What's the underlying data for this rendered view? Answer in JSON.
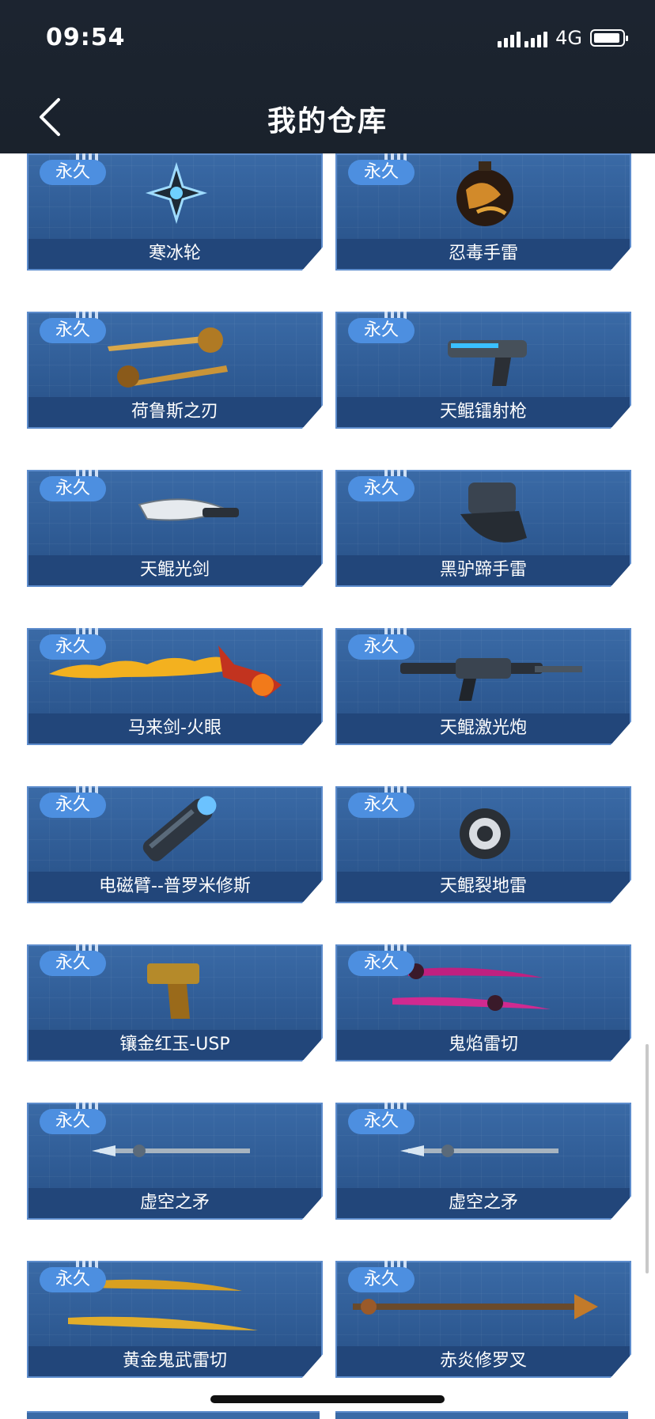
{
  "status": {
    "time": "09:54",
    "network": "4G"
  },
  "header": {
    "title": "我的仓库"
  },
  "items": [
    {
      "badge": "永久",
      "name": "寒冰轮",
      "icon": "shuriken-icon"
    },
    {
      "badge": "永久",
      "name": "忍毒手雷",
      "icon": "grenade-icon"
    },
    {
      "badge": "永久",
      "name": "荷鲁斯之刃",
      "icon": "dagger-icon"
    },
    {
      "badge": "永久",
      "name": "天鲲镭射枪",
      "icon": "laser-pistol-icon"
    },
    {
      "badge": "永久",
      "name": "天鲲光剑",
      "icon": "lightsaber-icon"
    },
    {
      "badge": "永久",
      "name": "黑驴蹄手雷",
      "icon": "hoof-grenade-icon"
    },
    {
      "badge": "永久",
      "name": "马来剑-火眼",
      "icon": "flame-sword-icon"
    },
    {
      "badge": "永久",
      "name": "天鲲激光炮",
      "icon": "laser-cannon-icon"
    },
    {
      "badge": "永久",
      "name": "电磁臂--普罗米修斯",
      "icon": "arm-icon"
    },
    {
      "badge": "永久",
      "name": "天鲲裂地雷",
      "icon": "mine-icon"
    },
    {
      "badge": "永久",
      "name": "镶金红玉-USP",
      "icon": "pistol-icon"
    },
    {
      "badge": "永久",
      "name": "鬼焰雷切",
      "icon": "twin-blades-icon"
    },
    {
      "badge": "永久",
      "name": "虚空之矛",
      "icon": "spear-icon"
    },
    {
      "badge": "永久",
      "name": "虚空之矛",
      "icon": "spear-icon"
    },
    {
      "badge": "永久",
      "name": "黄金鬼武雷切",
      "icon": "golden-blades-icon"
    },
    {
      "badge": "永久",
      "name": "赤炎修罗叉",
      "icon": "trident-icon"
    }
  ]
}
